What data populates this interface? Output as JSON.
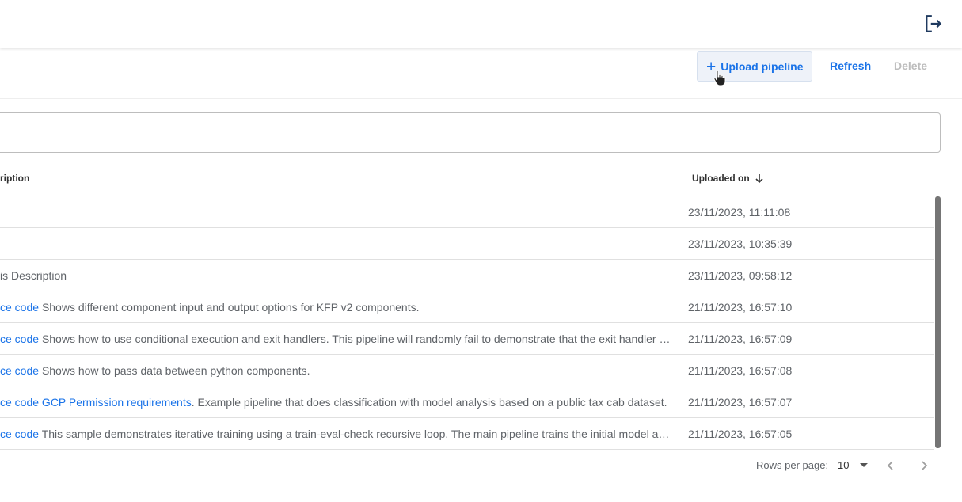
{
  "header": {
    "logout_icon": "logout-icon"
  },
  "toolbar": {
    "upload_label": "Upload pipeline",
    "refresh_label": "Refresh",
    "delete_label": "Delete"
  },
  "filter": {
    "value": ""
  },
  "table": {
    "columns": {
      "description": "ription",
      "uploaded_on": "Uploaded on"
    },
    "rows": [
      {
        "link": "",
        "text": "",
        "date": "23/11/2023, 11:11:08"
      },
      {
        "link": "",
        "text": "",
        "date": "23/11/2023, 10:35:39"
      },
      {
        "link": "",
        "text": "is Description",
        "date": "23/11/2023, 09:58:12"
      },
      {
        "link": "ce code",
        "text": "Shows different component input and output options for KFP v2 components.",
        "date": "21/11/2023, 16:57:10"
      },
      {
        "link": "ce code",
        "text": "Shows how to use conditional execution and exit handlers. This pipeline will randomly fail to demonstrate that the exit handler gets executed even in case of an error.",
        "date": "21/11/2023, 16:57:09"
      },
      {
        "link": "ce code",
        "text": "Shows how to pass data between python components.",
        "date": "21/11/2023, 16:57:08"
      },
      {
        "link": "ce code GCP Permission requirements",
        "text": ". Example pipeline that does classification with model analysis based on a public tax cab dataset.",
        "date": "21/11/2023, 16:57:07"
      },
      {
        "link": "ce code",
        "text": "This sample demonstrates iterative training using a train-eval-check recursive loop. The main pipeline trains the initial model and then gradually trains the model.",
        "date": "21/11/2023, 16:57:05"
      }
    ]
  },
  "pagination": {
    "rows_per_page_label": "Rows per page:",
    "rows_per_page_value": "10"
  },
  "colors": {
    "accent": "#1a73e8",
    "disabled": "#bdbdbd"
  }
}
